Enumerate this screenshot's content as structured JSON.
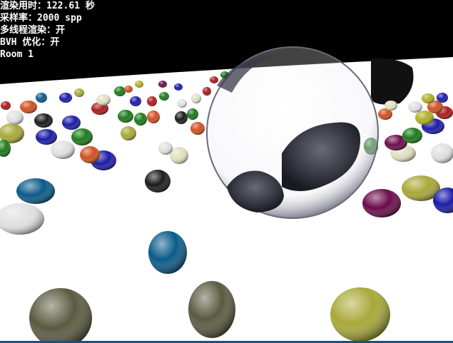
{
  "overlay": {
    "render_time": {
      "label": "渲染用时",
      "sep": "：",
      "value": "122.61 秒"
    },
    "sample_rate": {
      "label": "采样率",
      "sep": "：",
      "value": "2000 spp"
    },
    "multithread": {
      "label": "多线程渲染",
      "sep": "：",
      "value": "开"
    },
    "bvh": {
      "label": "BVH 优化",
      "sep": "：",
      "value": "开"
    },
    "scene_name": "Room 1"
  },
  "colors": {
    "sky": "#000000",
    "floor": "#ffffff",
    "bottom_bar": "#1f4f7a",
    "sphere_palette": [
      "#1a1aa8",
      "#1a7a1a",
      "#b0b020",
      "#e0e0e0",
      "#6a0a4a",
      "#0a5a8a",
      "#d05020",
      "#1a1a1a",
      "#aa1a1a",
      "#a8a838",
      "#e0e0c0",
      "#5a5a40"
    ]
  }
}
